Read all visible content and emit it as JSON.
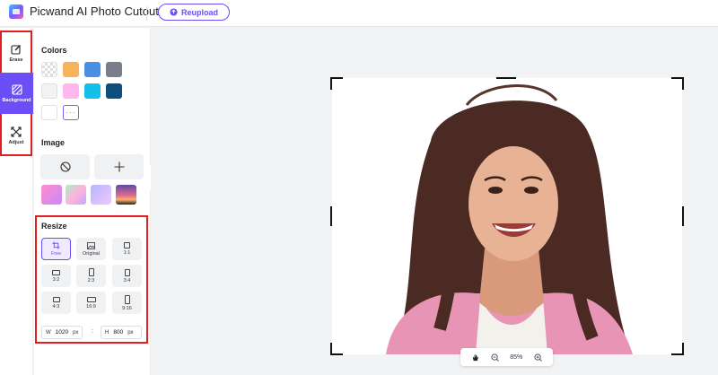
{
  "app": {
    "title": "Picwand AI Photo Cutout",
    "reupload_label": "Reupload"
  },
  "tools": [
    {
      "label": "Erase",
      "icon": "erase-icon",
      "active": false
    },
    {
      "label": "Background",
      "icon": "background-icon",
      "active": true
    },
    {
      "label": "Adjust",
      "icon": "adjust-icon",
      "active": false
    }
  ],
  "panel": {
    "colors_title": "Colors",
    "colors": [
      "transparent",
      "#f9b25c",
      "#4a90e2",
      "#7a7d8c",
      "#f3f3f3",
      "#ffb8ee",
      "#14bfe8",
      "#0d4e7d",
      "#ffffff"
    ],
    "more_label": "···",
    "image_title": "Image",
    "image_buttons": [
      {
        "icon": "no-image-icon"
      },
      {
        "icon": "plus-icon"
      }
    ],
    "image_thumbs": [
      "pink-gradient",
      "rainbow-gradient",
      "purple-gradient",
      "sunset-photo"
    ],
    "resize_title": "Resize",
    "resize_options": [
      {
        "label": "Free",
        "icon": "crop-icon",
        "active": true
      },
      {
        "label": "Original",
        "icon": "image-icon",
        "active": false
      },
      {
        "label": "1:1",
        "icon": "ratio-1-1-icon",
        "active": false
      },
      {
        "label": "3:2",
        "icon": "ratio-3-2-icon",
        "active": false
      },
      {
        "label": "2:3",
        "icon": "ratio-2-3-icon",
        "active": false
      },
      {
        "label": "3:4",
        "icon": "ratio-3-4-icon",
        "active": false
      },
      {
        "label": "4:3",
        "icon": "ratio-4-3-icon",
        "active": false
      },
      {
        "label": "16:9",
        "icon": "ratio-16-9-icon",
        "active": false
      },
      {
        "label": "9:16",
        "icon": "ratio-9-16-icon",
        "active": false
      }
    ],
    "width_label": "W",
    "width_value": "1020",
    "width_unit": "px",
    "height_label": "H",
    "height_value": "800",
    "height_unit": "px",
    "separator": ":"
  },
  "canvas": {
    "zoom": "85%"
  },
  "accent": "#6b4ef6"
}
